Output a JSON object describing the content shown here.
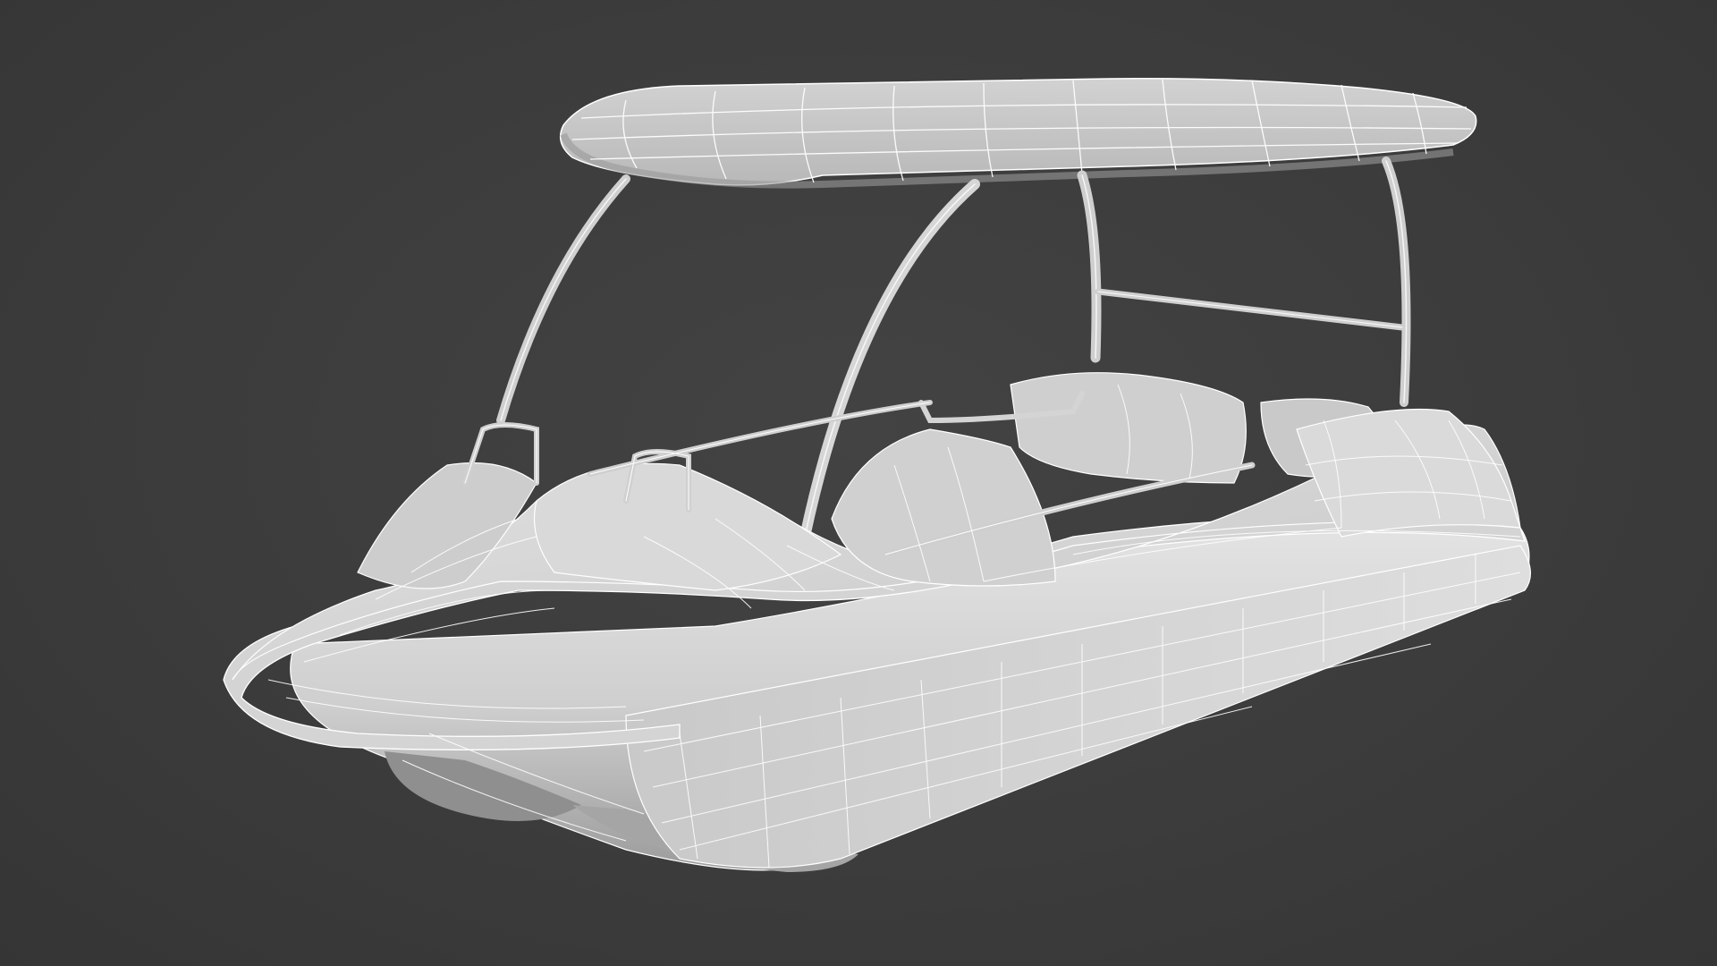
{
  "scene": {
    "subject": "pedal-boat-wireframe-render",
    "colors": {
      "background": "#3c3c3c",
      "model_surface": "#d8d8d8",
      "model_shadow": "#9a9a9a",
      "wireframe": "#ffffff"
    }
  }
}
